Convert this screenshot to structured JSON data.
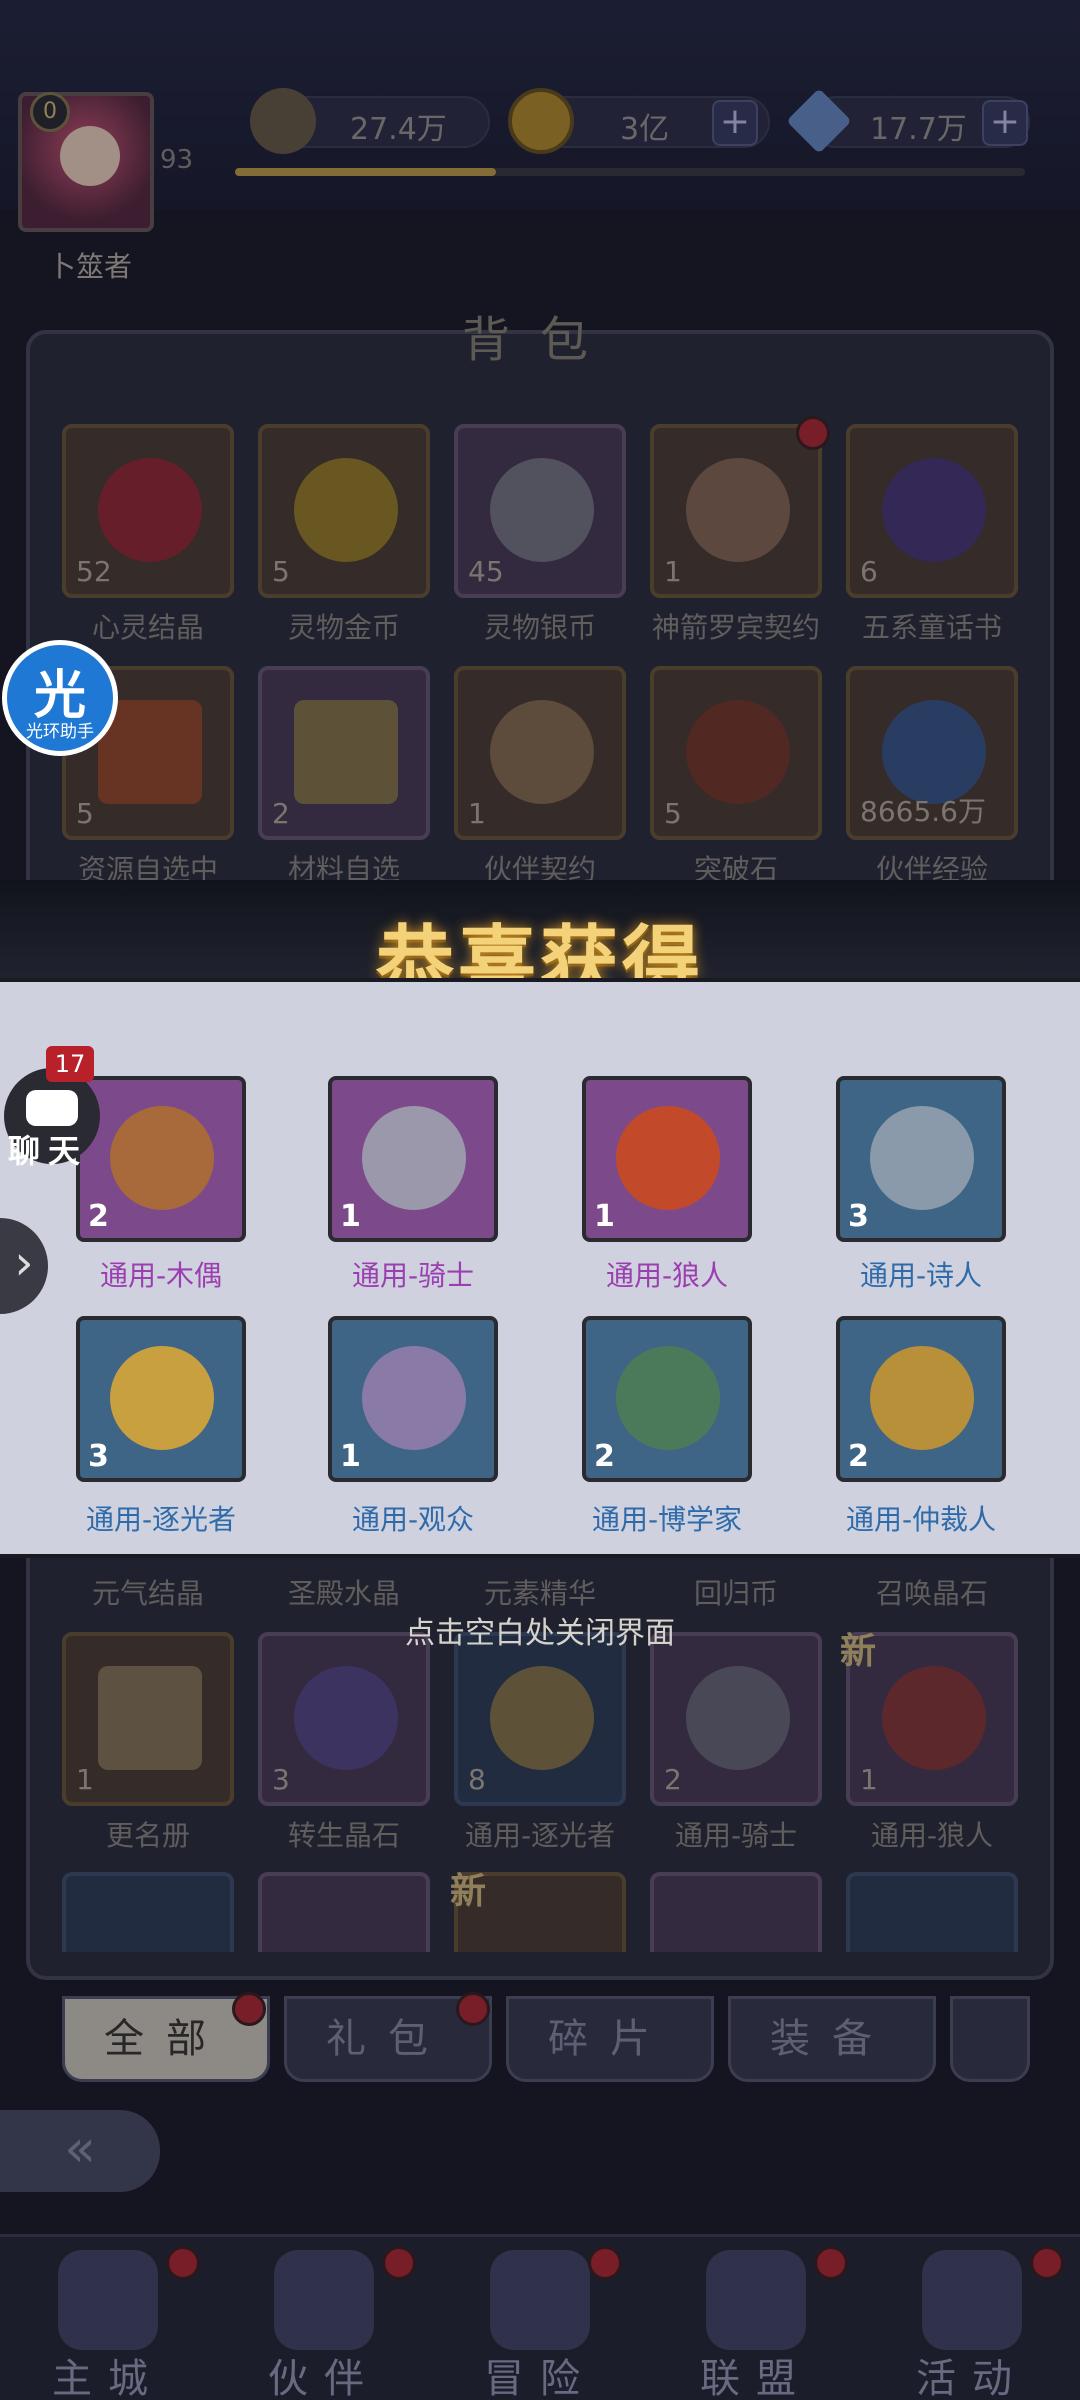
{
  "player": {
    "level": "0",
    "name": "卜筮者",
    "number": "93"
  },
  "resources": [
    {
      "name": "power",
      "value": "27.4万",
      "icon": "sword-power-icon"
    },
    {
      "name": "gold",
      "value": "3亿",
      "icon": "gold-coin-icon"
    },
    {
      "name": "diamond",
      "value": "17.7万",
      "icon": "diamond-icon"
    }
  ],
  "plus_label": "+",
  "exp_progress_fraction": 0.33,
  "backpack": {
    "title": "背包",
    "row1": [
      {
        "name": "心灵结晶",
        "count": "52"
      },
      {
        "name": "灵物金币",
        "count": "5"
      },
      {
        "name": "灵物银币",
        "count": "45"
      },
      {
        "name": "神箭罗宾契约",
        "count": "1"
      },
      {
        "name": "五系童话书",
        "count": "6"
      }
    ],
    "row2": [
      {
        "name": "资源自选中",
        "count": "5"
      },
      {
        "name": "材料自选",
        "count": "2"
      },
      {
        "name": "伙伴契约",
        "count": "1"
      },
      {
        "name": "突破石",
        "count": "5"
      },
      {
        "name": "伙伴经验",
        "count": "8665.6万"
      }
    ],
    "row3_names": [
      "元气结晶",
      "圣殿水晶",
      "元素精华",
      "回归币",
      "召唤晶石"
    ],
    "row4": [
      {
        "name": "更名册",
        "count": "1"
      },
      {
        "name": "转生晶石",
        "count": "3"
      },
      {
        "name": "通用-逐光者",
        "count": "8"
      },
      {
        "name": "通用-骑士",
        "count": "2"
      },
      {
        "name": "通用-狼人",
        "count": "1"
      }
    ],
    "new_label": "新"
  },
  "reward": {
    "title": "恭喜获得",
    "items": [
      {
        "name": "通用-木偶",
        "count": "2",
        "rarity": "purple"
      },
      {
        "name": "通用-骑士",
        "count": "1",
        "rarity": "purple"
      },
      {
        "name": "通用-狼人",
        "count": "1",
        "rarity": "purple"
      },
      {
        "name": "通用-诗人",
        "count": "3",
        "rarity": "blue"
      },
      {
        "name": "通用-逐光者",
        "count": "3",
        "rarity": "blue"
      },
      {
        "name": "通用-观众",
        "count": "1",
        "rarity": "blue"
      },
      {
        "name": "通用-博学家",
        "count": "2",
        "rarity": "blue"
      },
      {
        "name": "通用-仲裁人",
        "count": "2",
        "rarity": "blue"
      }
    ],
    "close_hint": "点击空白处关闭界面"
  },
  "assistant": {
    "char": "光",
    "label": "光环助手"
  },
  "chat": {
    "label": "聊天",
    "badge": "17"
  },
  "tabs": [
    "全部",
    "礼包",
    "碎片",
    "装备"
  ],
  "nav": [
    "主城",
    "伙伴",
    "冒险",
    "联盟",
    "活动"
  ],
  "colors": {
    "gold_title": "#f4d27a",
    "purple_text": "#9b3fb0",
    "blue_text": "#2f6bab",
    "red_dot": "#b22a33"
  }
}
